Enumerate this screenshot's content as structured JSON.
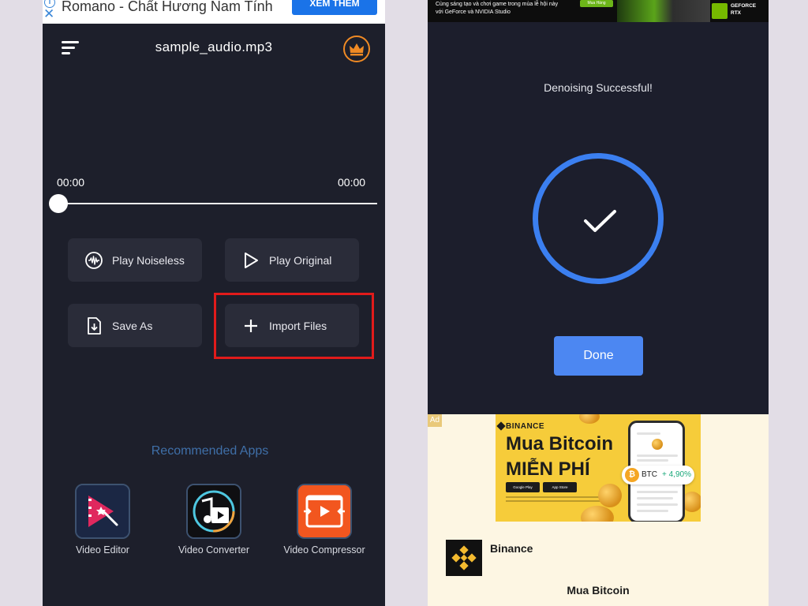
{
  "left_screen": {
    "ad": {
      "text": "Romano - Chất Hương Nam Tính",
      "cta": "XEM THÊM",
      "info_glyph": "i",
      "close_glyph": "✕"
    },
    "header": {
      "title": "sample_audio.mp3",
      "menu_icon": "hamburger-menu-icon",
      "premium_icon": "crown-icon",
      "accent_color": "#f08a24"
    },
    "player": {
      "current_time": "00:00",
      "total_time": "00:00",
      "progress": 0
    },
    "actions": {
      "play_noiseless": "Play Noiseless",
      "play_original": "Play Original",
      "save_as": "Save As",
      "import_files": "Import Files"
    },
    "highlight_color": "#e11b1b",
    "recommended": {
      "title": "Recommended Apps",
      "apps": [
        {
          "label": "Video Editor",
          "icon": "video-editor-icon"
        },
        {
          "label": "Video Converter",
          "icon": "video-converter-icon"
        },
        {
          "label": "Video Compressor",
          "icon": "video-compressor-icon"
        }
      ]
    }
  },
  "right_screen": {
    "top_ad": {
      "line1": "Cùng sáng tạo và chơi game trong mùa lễ hội này",
      "line2": "với GeForce và NVIDIA Studio",
      "tag": "Mua Hàng",
      "brand_line1": "GEFORCE",
      "brand_line2": "RTX"
    },
    "message": "Denoising Successful!",
    "status_icon": "checkmark-icon",
    "accent_color": "#3b7ff0",
    "done_label": "Done",
    "bottom_ad": {
      "badge": "Ad",
      "brand": "BINANCE",
      "headline1": "Mua Bitcoin",
      "headline2": "MIỄN PHÍ",
      "store1": "Google Play",
      "store2": "App Store",
      "ticker": "BTC",
      "change": "+ 4,90%",
      "advertiser": "Binance",
      "cta": "Mua Bitcoin",
      "brand_color": "#f6cc3a"
    }
  }
}
